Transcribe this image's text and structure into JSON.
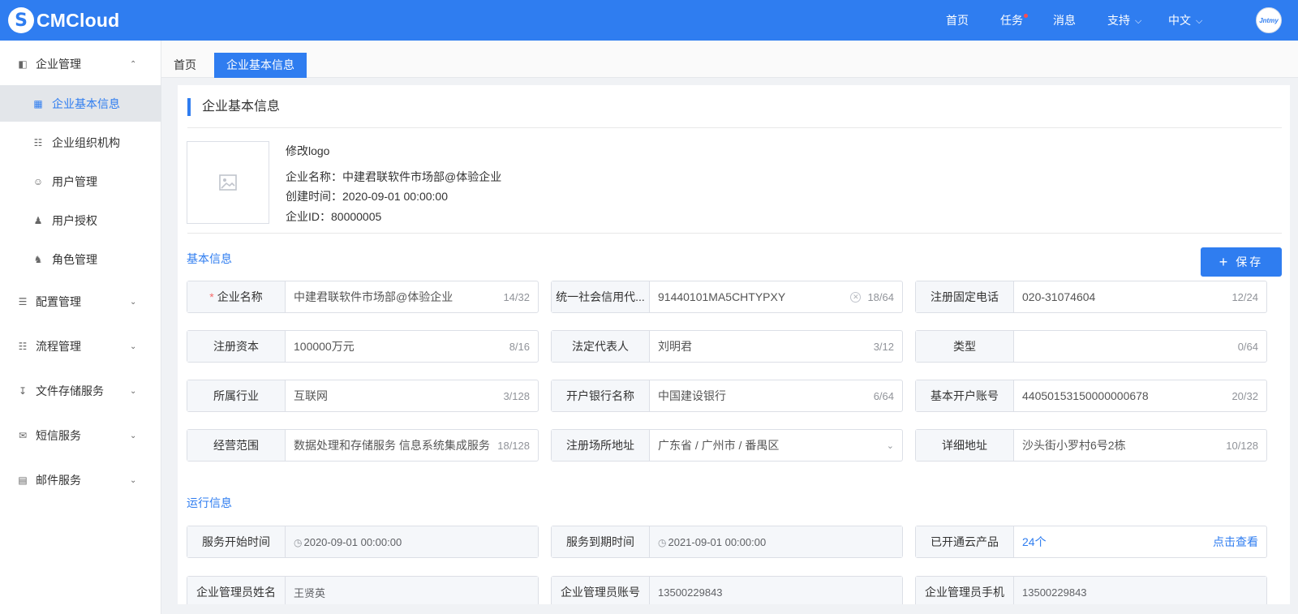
{
  "header": {
    "logo_mark": "S",
    "logo_text": "CMCloud",
    "nav": {
      "home": "首页",
      "tasks": "任务",
      "messages": "消息",
      "support": "支持",
      "language": "中文"
    },
    "avatar_text": "Jntmy"
  },
  "sidebar": {
    "groups": {
      "enterprise": "企业管理",
      "config": "配置管理",
      "workflow": "流程管理",
      "file_storage": "文件存储服务",
      "sms": "短信服务",
      "email": "邮件服务"
    },
    "items": {
      "basic_info": "企业基本信息",
      "org": "企业组织机构",
      "users": "用户管理",
      "user_auth": "用户授权",
      "roles": "角色管理"
    }
  },
  "tabs": {
    "home": "首页",
    "basic_info": "企业基本信息"
  },
  "panel": {
    "title": "企业基本信息",
    "change_logo": "修改logo",
    "company_name_line": "企业名称：中建君联软件市场部@体验企业",
    "created_line": "创建时间：2020-09-01 00:00:00",
    "company_id_line": "企业ID：80000005",
    "basic_section": "基本信息",
    "save_label": "保存",
    "run_section": "运行信息"
  },
  "fields": {
    "company_name": {
      "label": "企业名称",
      "value": "中建君联软件市场部@体验企业",
      "count": "14/32"
    },
    "credit_code": {
      "label": "统一社会信用代...",
      "value": "91440101MA5CHTYPXY",
      "count": "18/64"
    },
    "phone": {
      "label": "注册固定电话",
      "value": "020-31074604",
      "count": "12/24"
    },
    "capital": {
      "label": "注册资本",
      "value": "100000万元",
      "count": "8/16"
    },
    "legal_rep": {
      "label": "法定代表人",
      "value": "刘明君",
      "count": "3/12"
    },
    "type": {
      "label": "类型",
      "value": "",
      "count": "0/64"
    },
    "industry": {
      "label": "所属行业",
      "value": "互联网",
      "count": "3/128"
    },
    "bank_name": {
      "label": "开户银行名称",
      "value": "中国建设银行",
      "count": "6/64"
    },
    "account": {
      "label": "基本开户账号",
      "value": "44050153150000000678",
      "count": "20/32"
    },
    "scope": {
      "label": "经营范围",
      "value": "数据处理和存储服务 信息系统集成服务",
      "count": "18/128"
    },
    "reg_address": {
      "label": "注册场所地址",
      "value": "广东省 / 广州市 / 番禺区"
    },
    "detail_address": {
      "label": "详细地址",
      "value": "沙头街小罗村6号2栋",
      "count": "10/128"
    },
    "service_start": {
      "label": "服务开始时间",
      "value": "2020-09-01 00:00:00"
    },
    "service_end": {
      "label": "服务到期时间",
      "value": "2021-09-01 00:00:00"
    },
    "products": {
      "label": "已开通云产品",
      "value": "24个",
      "link": "点击查看"
    },
    "admin_name": {
      "label": "企业管理员姓名",
      "value": "王贤英"
    },
    "admin_account": {
      "label": "企业管理员账号",
      "value": "13500229843"
    },
    "admin_phone": {
      "label": "企业管理员手机",
      "value": "13500229843"
    }
  },
  "colors": {
    "primary": "#2f7df0",
    "required": "#f56c6c",
    "active_menu_bg": "#e3e6ea"
  }
}
